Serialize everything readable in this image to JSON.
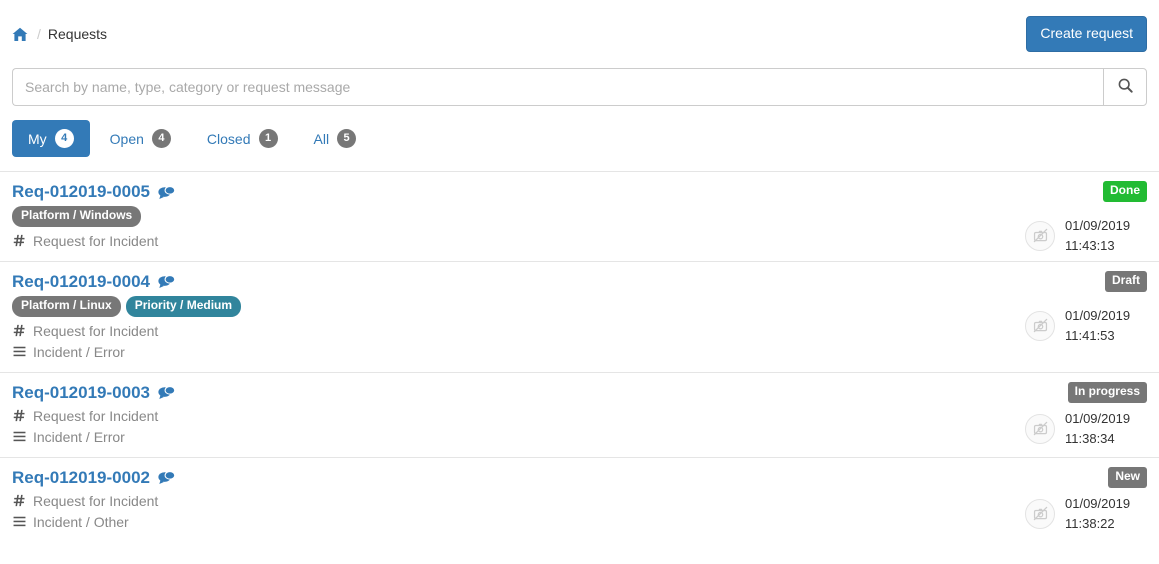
{
  "header": {
    "breadcrumb": {
      "home_icon": "home-icon",
      "separator": "/",
      "current": "Requests"
    },
    "create_button": "Create request"
  },
  "search": {
    "placeholder": "Search by name, type, category or request message",
    "value": "",
    "button_icon": "search-icon"
  },
  "tabs": [
    {
      "label": "My",
      "count": "4",
      "active": true
    },
    {
      "label": "Open",
      "count": "4",
      "active": false
    },
    {
      "label": "Closed",
      "count": "1",
      "active": false
    },
    {
      "label": "All",
      "count": "5",
      "active": false
    }
  ],
  "colors": {
    "primary": "#337ab7",
    "badge_gray": "#777777",
    "badge_teal": "#31859c",
    "status_done_green": "#22bb33",
    "divider": "#e5e5e5"
  },
  "requests": [
    {
      "id": "Req-012019-0005",
      "comments_icon": "comments-icon",
      "badges": [
        {
          "label": "Platform / Windows",
          "color": "gray"
        }
      ],
      "type": "Request for Incident",
      "category": "",
      "status": {
        "label": "Done",
        "color": "green"
      },
      "date": "01/09/2019",
      "time": "11:43:13"
    },
    {
      "id": "Req-012019-0004",
      "comments_icon": "comments-icon",
      "badges": [
        {
          "label": "Platform / Linux",
          "color": "gray"
        },
        {
          "label": "Priority / Medium",
          "color": "teal"
        }
      ],
      "type": "Request for Incident",
      "category": "Incident / Error",
      "status": {
        "label": "Draft",
        "color": "gray"
      },
      "date": "01/09/2019",
      "time": "11:41:53"
    },
    {
      "id": "Req-012019-0003",
      "comments_icon": "comments-icon",
      "badges": [],
      "type": "Request for Incident",
      "category": "Incident / Error",
      "status": {
        "label": "In progress",
        "color": "gray"
      },
      "date": "01/09/2019",
      "time": "11:38:34"
    },
    {
      "id": "Req-012019-0002",
      "comments_icon": "comments-icon",
      "badges": [],
      "type": "Request for Incident",
      "category": "Incident / Other",
      "status": {
        "label": "New",
        "color": "gray"
      },
      "date": "01/09/2019",
      "time": "11:38:22"
    }
  ]
}
